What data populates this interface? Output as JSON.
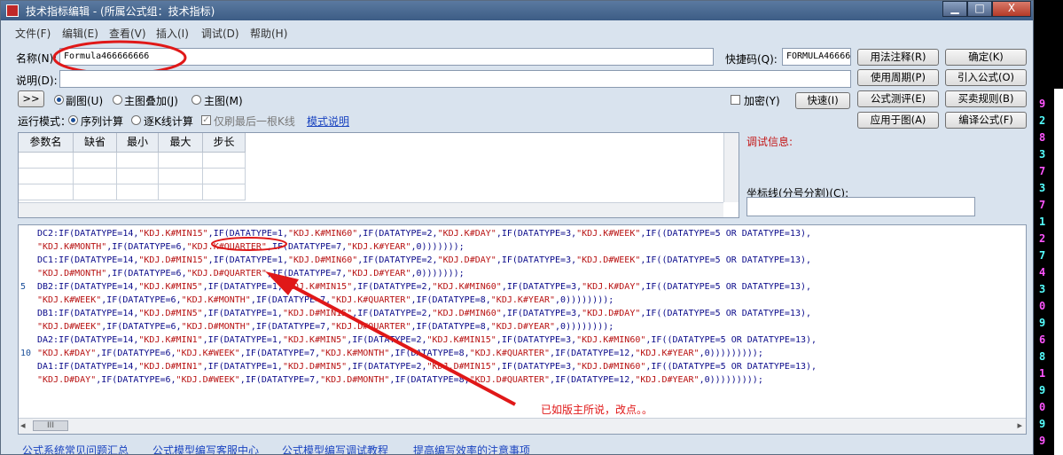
{
  "window": {
    "title": "技术指标编辑 - (所属公式组：技术指标)",
    "min_label": "▁",
    "max_label": "□",
    "close_label": "X"
  },
  "menu": [
    "文件(F)",
    "编辑(E)",
    "查看(V)",
    "插入(I)",
    "调试(D)",
    "帮助(H)"
  ],
  "form": {
    "name_label": "名称(N):",
    "name_value": "Formula466666666",
    "shortcut_label": "快捷码(Q):",
    "shortcut_value": "FORMULA46666",
    "desc_label": "说明(D):",
    "desc_value": ""
  },
  "right_buttons": {
    "usage_note": "用法注释(R)",
    "ok": "确定(K)",
    "use_period": "使用周期(P)",
    "import_formula": "引入公式(O)",
    "formula_test": "公式测评(E)",
    "trade_rules": "买卖规则(B)",
    "apply_chart": "应用于图(A)",
    "compile": "编译公式(F)"
  },
  "display": {
    "expand_btn": ">>",
    "sub_chart": "副图(U)",
    "main_overlay": "主图叠加(J)",
    "main_chart": "主图(M)",
    "encrypt": "加密(Y)",
    "fast": "快速(I)"
  },
  "run_mode": {
    "label": "运行模式：",
    "sequential": "序列计算",
    "per_bar": "逐K线计算",
    "last_only": "仅刷最后一根K线",
    "mode_help": "模式说明"
  },
  "params_table": {
    "headers": [
      "参数名",
      "缺省",
      "最小",
      "最大",
      "步长"
    ],
    "rows": [
      [
        "",
        "",
        "",
        "",
        ""
      ],
      [
        "",
        "",
        "",
        "",
        ""
      ],
      [
        "",
        "",
        "",
        "",
        ""
      ]
    ]
  },
  "debug": {
    "label": "调试信息:",
    "axis_label": "坐标线(分号分割)(C):",
    "axis_value": ""
  },
  "code": {
    "line_numbers": [
      "5",
      "10"
    ],
    "lines": [
      "DC2:IF(DATATYPE=14,\"KDJ.K#MIN15\",IF(DATATYPE=1,\"KDJ.K#MIN60\",IF(DATATYPE=2,\"KDJ.K#DAY\",IF(DATATYPE=3,\"KDJ.K#WEEK\",IF((DATATYPE=5 OR DATATYPE=13),",
      "\"KDJ.K#MONTH\",IF(DATATYPE=6,\"KDJ.K#QUARTER\",IF(DATATYPE=7,\"KDJ.K#YEAR\",0)))))));",
      "DC1:IF(DATATYPE=14,\"KDJ.D#MIN15\",IF(DATATYPE=1,\"KDJ.D#MIN60\",IF(DATATYPE=2,\"KDJ.D#DAY\",IF(DATATYPE=3,\"KDJ.D#WEEK\",IF((DATATYPE=5 OR DATATYPE=13),",
      "\"KDJ.D#MONTH\",IF(DATATYPE=6,\"KDJ.D#QUARTER\",IF(DATATYPE=7,\"KDJ.D#YEAR\",0)))))));",
      "DB2:IF(DATATYPE=14,\"KDJ.K#MIN5\",IF(DATATYPE=1,\"KDJ.K#MIN15\",IF(DATATYPE=2,\"KDJ.K#MIN60\",IF(DATATYPE=3,\"KDJ.K#DAY\",IF((DATATYPE=5 OR DATATYPE=13),",
      "\"KDJ.K#WEEK\",IF(DATATYPE=6,\"KDJ.K#MONTH\",IF(DATATYPE=7,\"KDJ.K#QUARTER\",IF(DATATYPE=8,\"KDJ.K#YEAR\",0))))))));",
      "DB1:IF(DATATYPE=14,\"KDJ.D#MIN5\",IF(DATATYPE=1,\"KDJ.D#MIN15\",IF(DATATYPE=2,\"KDJ.D#MIN60\",IF(DATATYPE=3,\"KDJ.D#DAY\",IF((DATATYPE=5 OR DATATYPE=13),",
      "\"KDJ.D#WEEK\",IF(DATATYPE=6,\"KDJ.D#MONTH\",IF(DATATYPE=7,\"KDJ.D#QUARTER\",IF(DATATYPE=8,\"KDJ.D#YEAR\",0))))))));",
      "DA2:IF(DATATYPE=14,\"KDJ.K#MIN1\",IF(DATATYPE=1,\"KDJ.K#MIN5\",IF(DATATYPE=2,\"KDJ.K#MIN15\",IF(DATATYPE=3,\"KDJ.K#MIN60\",IF((DATATYPE=5 OR DATATYPE=13),",
      "\"KDJ.K#DAY\",IF(DATATYPE=6,\"KDJ.K#WEEK\",IF(DATATYPE=7,\"KDJ.K#MONTH\",IF(DATATYPE=8,\"KDJ.K#QUARTER\",IF(DATATYPE=12,\"KDJ.K#YEAR\",0)))))))));",
      "DA1:IF(DATATYPE=14,\"KDJ.D#MIN1\",IF(DATATYPE=1,\"KDJ.D#MIN5\",IF(DATATYPE=2,\"KDJ.D#MIN15\",IF(DATATYPE=3,\"KDJ.D#MIN60\",IF((DATATYPE=5 OR DATATYPE=13),",
      "\"KDJ.D#DAY\",IF(DATATYPE=6,\"KDJ.D#WEEK\",IF(DATATYPE=7,\"KDJ.D#MONTH\",IF(DATATYPE=8,\"KDJ.D#QUARTER\",IF(DATATYPE=12,\"KDJ.D#YEAR\",0)))))))));"
    ],
    "annotation": "已如版主所说，改点。。"
  },
  "scroll_grip": "III",
  "bottom_links": [
    "公式系统常见问题汇总",
    "公式模型编写客服中心",
    "公式模型编写调试教程",
    "提高编写效率的注意事项"
  ],
  "side_digits": [
    "9",
    "2",
    "8",
    "3",
    "7",
    "3",
    "7",
    "1",
    "2",
    "7",
    "4",
    "3",
    "0",
    "9",
    "6",
    "8",
    "1",
    "9",
    "0",
    "9",
    "9"
  ],
  "colors": {
    "title_bar": "#3c5c85",
    "annotation": "#e01818",
    "link": "#1a44c0",
    "code_keyword": "#0a0a8a",
    "code_string": "#b81212"
  }
}
